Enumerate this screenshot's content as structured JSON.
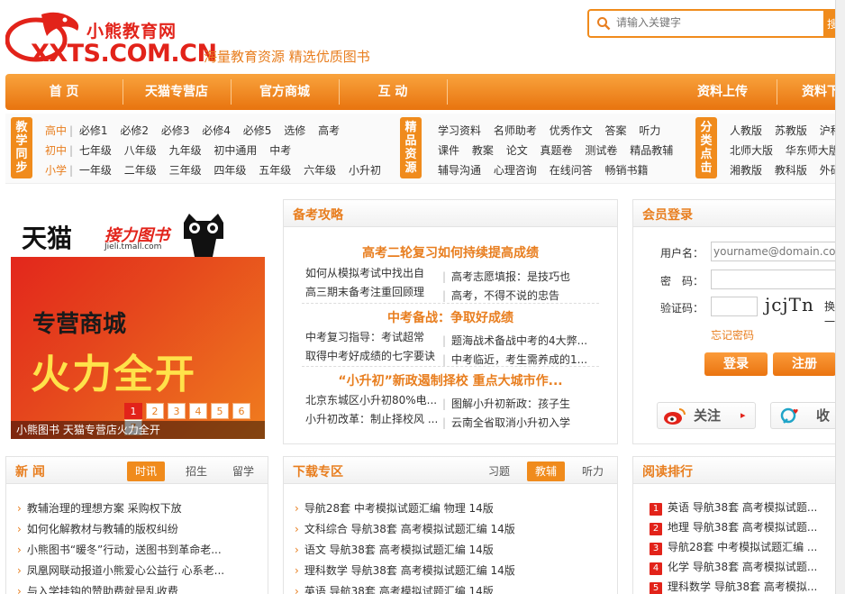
{
  "header": {
    "brand_cn": "小熊教育网",
    "brand_domain": "XXTS.COM.CN",
    "slogan": "海量教育资源 精选优质图书",
    "search_placeholder": "请输入关键字",
    "search_button": "搜"
  },
  "nav": [
    "首 页",
    "天猫专营店",
    "官方商城",
    "互 动",
    "资料上传",
    "资料下"
  ],
  "categories": {
    "jiaoxue": {
      "badge": "教学同步",
      "rows": [
        {
          "lead": "高中",
          "items": [
            "必修1",
            "必修2",
            "必修3",
            "必修4",
            "必修5",
            "选修",
            "高考"
          ]
        },
        {
          "lead": "初中",
          "items": [
            "七年级",
            "八年级",
            "九年级",
            "初中通用",
            "中考"
          ]
        },
        {
          "lead": "小学",
          "items": [
            "一年级",
            "二年级",
            "三年级",
            "四年级",
            "五年级",
            "六年级",
            "小升初"
          ]
        }
      ]
    },
    "jingpin": {
      "badge": "精品资源",
      "rows": [
        [
          "学习资料",
          "名师助考",
          "优秀作文",
          "答案",
          "听力"
        ],
        [
          "课件",
          "教案",
          "论文",
          "真题卷",
          "测试卷",
          "精品教辅"
        ],
        [
          "辅导沟通",
          "心理咨询",
          "在线问答",
          "畅销书籍"
        ]
      ]
    },
    "fenlei": {
      "badge": "分类点击",
      "rows": [
        [
          "人教版",
          "苏教版",
          "沪科"
        ],
        [
          "北师大版",
          "华东师大版"
        ],
        [
          "湘教版",
          "教科版",
          "外研版"
        ]
      ]
    }
  },
  "banner": {
    "brand": "天猫",
    "partner": "接力图书",
    "partner_url": "Jieli.tmall.com",
    "headline1": "专营商城",
    "headline2": "火力全开",
    "pages": [
      "1",
      "2",
      "3",
      "4",
      "5",
      "6",
      "7"
    ],
    "active_page": "1",
    "caption": "小熊图书 天猫专营店火力全开"
  },
  "guide": {
    "title": "备考攻略",
    "sections": [
      {
        "headline": "高考二轮复习如何持续提高成绩",
        "lines": [
          [
            "如何从模拟考试中找出自",
            "高考志愿填报：是技巧也"
          ],
          [
            "高三期末备考注重回顾理",
            "高考，不得不说的忠告"
          ]
        ]
      },
      {
        "headline": "中考备战：争取好成绩",
        "lines": [
          [
            "中考复习指导：考试超常",
            "题海战术备战中考的4大弊..."
          ],
          [
            "取得中考好成绩的七字要诀",
            "中考临近，考生需养成的1..."
          ]
        ]
      },
      {
        "headline": "“小升初”新政遏制择校 重点大城市作...",
        "lines": [
          [
            "北京东城区小升初80%电...",
            "图解小升初新政：孩子生"
          ],
          [
            "小升初改革：制止择校风 ...",
            "云南全省取消小升初入学"
          ]
        ]
      }
    ]
  },
  "login": {
    "title": "会员登录",
    "username_label": "用户名：",
    "username_placeholder": "yourname@domain.com",
    "password_label": "密　码：",
    "captcha_label": "验证码：",
    "captcha_text": "jcjTn",
    "captcha_refresh": "换一",
    "forgot": "忘记密码",
    "login_button": "登录",
    "register_button": "注册",
    "follow_button": "关注",
    "collect_button": "收"
  },
  "news": {
    "title": "新 闻",
    "tabs": [
      "时讯",
      "招生",
      "留学"
    ],
    "active_tab": "时讯",
    "items": [
      "教辅治理的理想方案 采购权下放",
      "如何化解教材与教辅的版权纠纷",
      "小熊图书“暖冬”行动，送图书到革命老...",
      "凤凰网联动报道小熊爱心公益行 心系老...",
      "与入学挂钩的赞助费就是乱收费"
    ]
  },
  "download": {
    "title": "下载专区",
    "tabs": [
      "习题",
      "教辅",
      "听力"
    ],
    "active_tab": "教辅",
    "items": [
      "导航28套 中考模拟试题汇编 物理 14版",
      "文科综合 导航38套 高考模拟试题汇编 14版",
      "语文 导航38套 高考模拟试题汇编 14版",
      "理科数学 导航38套 高考模拟试题汇编 14版",
      "英语 导航38套 高考模拟试题汇编 14版"
    ]
  },
  "ranking": {
    "title": "阅读排行",
    "items": [
      {
        "n": "1",
        "text": "英语 导航38套 高考模拟试题..."
      },
      {
        "n": "2",
        "text": "地理 导航38套 高考模拟试题..."
      },
      {
        "n": "3",
        "text": "导航28套 中考模拟试题汇编 ..."
      },
      {
        "n": "4",
        "text": "化学 导航38套 高考模拟试题..."
      },
      {
        "n": "5",
        "text": "理科数学 导航38套 高考模拟..."
      }
    ]
  },
  "colors": {
    "brand_red": "#e2231a",
    "accent_orange": "#f08b1c"
  }
}
